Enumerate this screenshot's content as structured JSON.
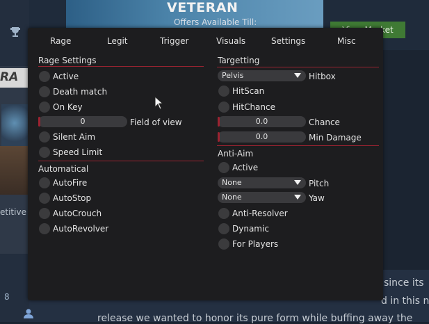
{
  "background": {
    "banner_title": "VETERAN",
    "offers_text": "Offers Available Till:",
    "market_button": "View Market",
    "rank_fragment": "RA",
    "mode_fragment": "etitive",
    "friend_count": "8",
    "body_text_1": "since its",
    "body_text_2": "d in this n",
    "body_text_3": "release we wanted to honor its pure form while buffing away the"
  },
  "tabs": [
    "Rage",
    "Legit",
    "Trigger",
    "Visuals",
    "Settings",
    "Misc"
  ],
  "rage_settings": {
    "title": "Rage Settings",
    "active": "Active",
    "deathmatch": "Death match",
    "on_key": "On Key",
    "fov_value": "0",
    "fov_label": "Field of view",
    "silent_aim": "Silent Aim",
    "speed_limit": "Speed Limit"
  },
  "automatical": {
    "title": "Automatical",
    "autofire": "AutoFire",
    "autostop": "AutoStop",
    "autocrouch": "AutoCrouch",
    "autorevolver": "AutoRevolver"
  },
  "targetting": {
    "title": "Targetting",
    "hitbox_value": "Pelvis",
    "hitbox_label": "Hitbox",
    "hitscan": "HitScan",
    "hitchance": "HitChance",
    "chance_value": "0.0",
    "chance_label": "Chance",
    "min_damage_value": "0.0",
    "min_damage_label": "Min Damage"
  },
  "anti_aim": {
    "title": "Anti-Aim",
    "active": "Active",
    "pitch_value": "None",
    "pitch_label": "Pitch",
    "yaw_value": "None",
    "yaw_label": "Yaw",
    "anti_resolver": "Anti-Resolver",
    "dynamic": "Dynamic",
    "for_players": "For Players"
  },
  "colors": {
    "accent": "#9b2331",
    "panel_bg": "#1d1d1f",
    "control_bg": "#3a3a3d"
  }
}
